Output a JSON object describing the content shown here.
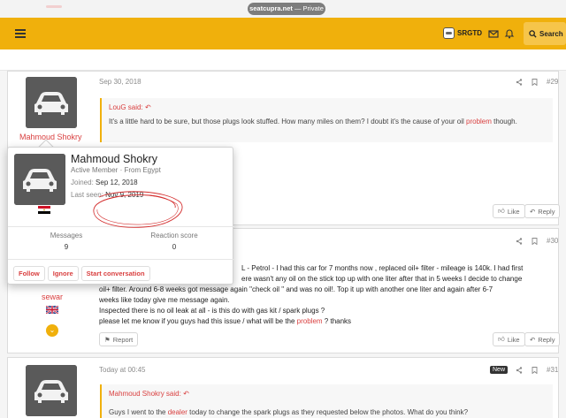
{
  "browser": {
    "domain": "seatcupra.net",
    "mode_sep": " — ",
    "mode": "Private"
  },
  "header": {
    "username": "SRGTD",
    "search_label": "Search"
  },
  "posts": [
    {
      "date": "Sep 30, 2018",
      "number": "#29",
      "author": "Mahmoud Shokry",
      "quote_author": "LouG said:",
      "body_before": "It's a little hard to be sure, but those plugs look stuffed. How many miles on them? I doubt it's the cause of your oil ",
      "body_link": "problem",
      "body_after": " though.",
      "like": "Like",
      "reply": "Reply"
    },
    {
      "number": "#30",
      "author": "sewar",
      "lines": [
        "L - Petrol - I had this car for 7 months now , replaced oil+ filter - mileage is 140k. I had first",
        "ere wasn't any oil on the stick top up with one liter after that in 5 weeks I decide to change",
        "oil+ filter. Around 6-8 weeks got message again \"check oil \" and was no oil!. Top it up with another one liter and again after 6-7",
        "weeks like today give me message again.",
        "Inspected there is no oil leak at all - is this do with gas kit / spark plugs ?"
      ],
      "last_before": "please let me know if you guys had this issue / what will be the ",
      "last_link": "problem",
      "last_after": " ? thanks",
      "report": "Report",
      "like": "Like",
      "reply": "Reply"
    },
    {
      "date": "Today at 00:45",
      "badge": "New",
      "number": "#31",
      "quote_author": "Mahmoud Shokry said:",
      "body_before": "Guys I went to the ",
      "body_link": "dealer",
      "body_after": " today to change the spark plugs as they requested below the photos. What do you think?"
    }
  ],
  "profile_card": {
    "name": "Mahmoud Shokry",
    "role": "Active Member · From Egypt",
    "joined_label": "Joined:",
    "joined_value": "Sep 12, 2018",
    "last_seen_label": "Last seen:",
    "last_seen_value": "Nov 9, 2019",
    "messages_label": "Messages",
    "messages_value": "9",
    "reaction_label": "Reaction score",
    "reaction_value": "0",
    "follow": "Follow",
    "ignore": "Ignore",
    "start_conversation": "Start conversation"
  },
  "colors": {
    "header": "#f0b00c",
    "accent_link": "#d94040",
    "annotation": "#d43030"
  }
}
